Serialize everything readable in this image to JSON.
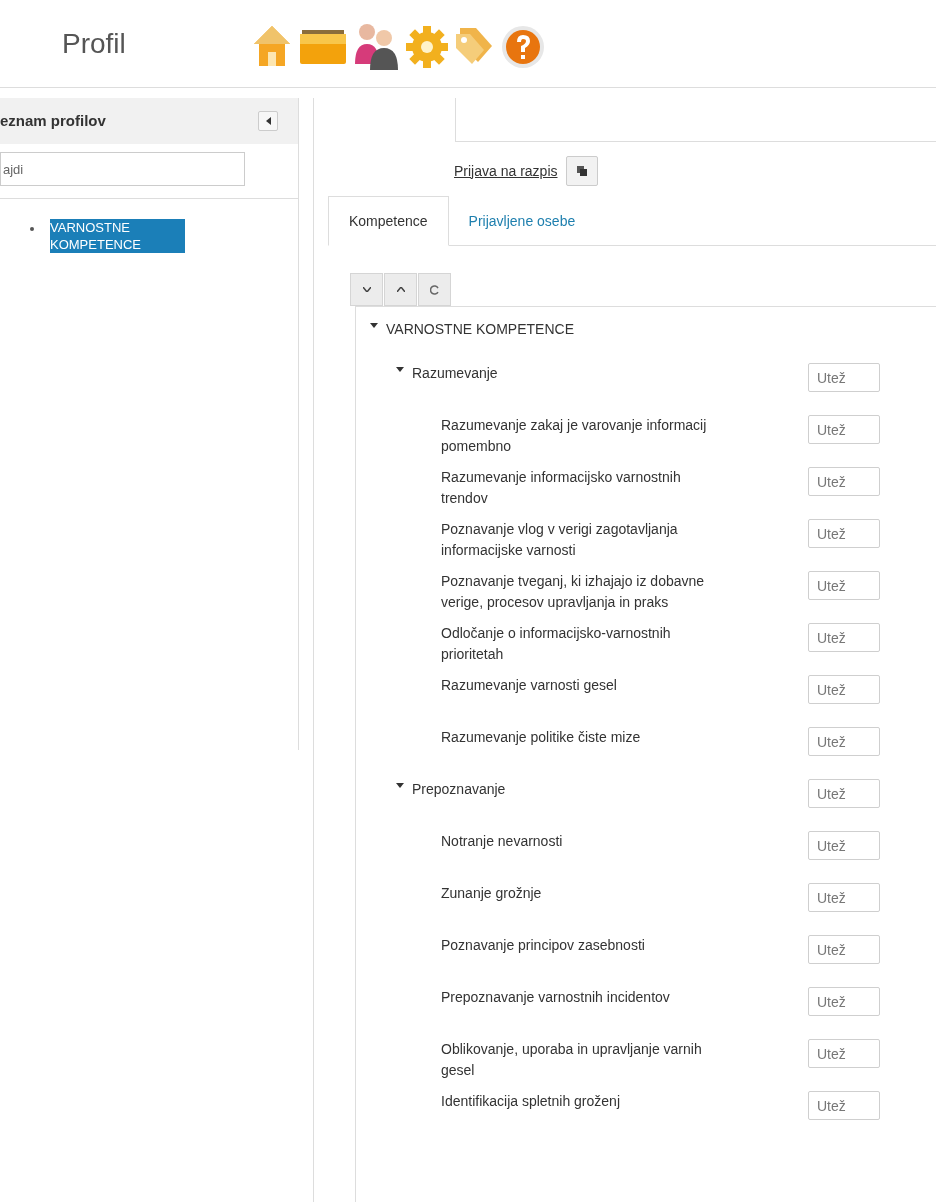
{
  "header": {
    "title": "Profil"
  },
  "sidebar": {
    "title": "eznam profilov",
    "search": {
      "placeholder": "ajdi"
    },
    "items": [
      {
        "label": "VARNOSTNE KOMPETENCE",
        "selected": true
      }
    ]
  },
  "main": {
    "link": "Prijava na razpis",
    "tabs": [
      {
        "label": "Kompetence",
        "selected": true
      },
      {
        "label": "Prijavljene osebe",
        "selected": false
      }
    ],
    "tree": [
      {
        "label": "VARNOSTNE KOMPETENCE",
        "expanded": true,
        "children": [
          {
            "label": "Razumevanje",
            "expanded": true,
            "placeholder": "Utež",
            "children": [
              {
                "label": "Razumevanje zakaj je varovanje informacij pomembno",
                "placeholder": "Utež"
              },
              {
                "label": "Razumevanje informacijsko varnostnih trendov",
                "placeholder": "Utež"
              },
              {
                "label": "Poznavanje vlog v verigi zagotavljanja informacijske varnosti",
                "placeholder": "Utež"
              },
              {
                "label": "Poznavanje tveganj, ki izhajajo iz dobavne verige, procesov upravljanja in praks",
                "placeholder": "Utež"
              },
              {
                "label": "Odločanje o informacijsko-varnostnih prioritetah",
                "placeholder": "Utež"
              },
              {
                "label": "Razumevanje varnosti gesel",
                "placeholder": "Utež"
              },
              {
                "label": "Razumevanje politike čiste mize",
                "placeholder": "Utež"
              }
            ]
          },
          {
            "label": "Prepoznavanje",
            "expanded": true,
            "placeholder": "Utež",
            "children": [
              {
                "label": "Notranje nevarnosti",
                "placeholder": "Utež"
              },
              {
                "label": "Zunanje grožnje",
                "placeholder": "Utež"
              },
              {
                "label": "Poznavanje principov zasebnosti",
                "placeholder": "Utež"
              },
              {
                "label": "Prepoznavanje varnostnih incidentov",
                "placeholder": "Utež"
              },
              {
                "label": "Oblikovanje, uporaba in upravljanje varnih gesel",
                "placeholder": "Utež"
              },
              {
                "label": "Identifikacija spletnih groženj",
                "placeholder": "Utež"
              }
            ]
          }
        ]
      }
    ]
  }
}
